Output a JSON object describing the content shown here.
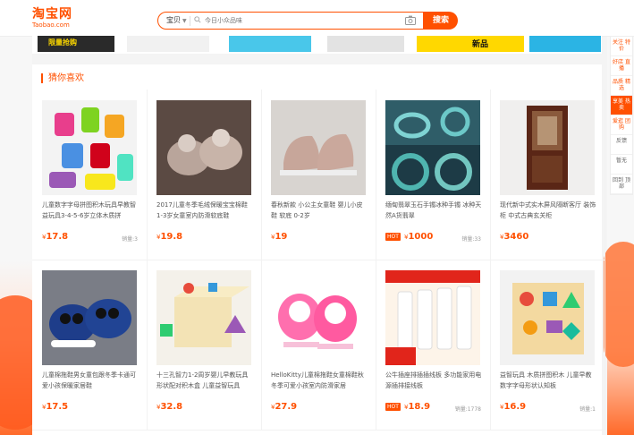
{
  "header": {
    "logo": "淘宝网",
    "logo_sub": "Taobao.com",
    "search_scope": "宝贝",
    "search_placeholder": "今日小众品味",
    "search_button": "搜索"
  },
  "banner": {
    "promo_text_1": "限量抢购",
    "promo_text_2": "新品"
  },
  "section": {
    "title": "猜你喜欢"
  },
  "products": [
    {
      "title": "儿童数字字母拼图积木玩具早教智益玩具3-4-5-6岁立体木质拼",
      "price": "17.8",
      "sold": "销量:3",
      "hot": false,
      "thumb": "toy-numbers"
    },
    {
      "title": "2017儿童冬季毛绒保暖宝宝棉鞋 1-3岁女童室内防滑软底鞋",
      "price": "19.8",
      "sold": "",
      "hot": false,
      "thumb": "fur-shoes"
    },
    {
      "title": "春秋新款 小公主女童鞋 婴儿小皮鞋 软底 0-2岁",
      "price": "19",
      "sold": "",
      "hot": false,
      "thumb": "baby-shoes"
    },
    {
      "title": "缅甸翡翠玉石手镯冰种手镯 冰种天然A货翡翠",
      "price": "1000",
      "sold": "销量:33",
      "hot": true,
      "hot_label": "HOT",
      "thumb": "jade-bangle"
    },
    {
      "title": "现代新中式实木屏风隔断客厅 装饰柜 中式古典玄关柜",
      "price": "3460",
      "sold": "",
      "hot": false,
      "thumb": "cabinet"
    },
    {
      "title": "儿童棉拖鞋男女童包跟冬季卡通可爱小孩保暖家居鞋",
      "price": "17.5",
      "sold": "",
      "hot": false,
      "thumb": "kid-slippers"
    },
    {
      "title": "十三孔智力1-2周岁婴儿早教玩具 形状配对积木盒 儿童益智玩具",
      "price": "32.8",
      "sold": "",
      "hot": false,
      "thumb": "shape-box"
    },
    {
      "title": "HelloKitty儿童棉拖鞋女童棉鞋秋冬季可爱小孩室内防滑家居",
      "price": "27.9",
      "sold": "",
      "hot": false,
      "thumb": "kitty-slippers"
    },
    {
      "title": "公牛插座排插插线板 多功能家用电源插排接线板",
      "price": "18.9",
      "sold": "销量:1778",
      "hot": true,
      "hot_label": "HOT",
      "thumb": "power-strip"
    },
    {
      "title": "益智玩具 木质拼图积木 儿童早教 数字字母形状认知板",
      "price": "16.9",
      "sold": "销量:1",
      "hot": false,
      "thumb": "puzzle-board"
    }
  ],
  "toolbar": [
    {
      "label": "关注 特价",
      "active": false
    },
    {
      "label": "好店 直播",
      "active": false
    },
    {
      "label": "品质 精选",
      "active": false
    },
    {
      "label": "享美 热卖",
      "active": true
    },
    {
      "label": "爱逛 团购",
      "active": false
    },
    {
      "label": "反馈",
      "active": false
    },
    {
      "label": "暂无",
      "active": false
    },
    {
      "label": "回到 顶部",
      "active": false
    }
  ]
}
